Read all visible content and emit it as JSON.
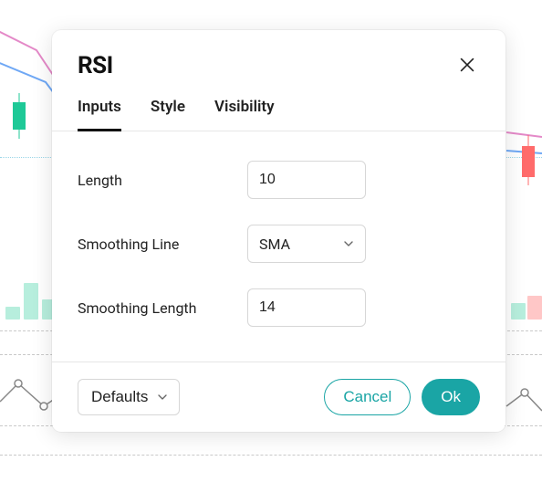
{
  "background": {
    "note": "faint trading chart behind modal",
    "visible_candle_colors": [
      "#1ec997",
      "#ff6b6b"
    ]
  },
  "modal": {
    "title": "RSI",
    "close_icon": "close-icon",
    "tabs": [
      {
        "label": "Inputs",
        "active": true
      },
      {
        "label": "Style",
        "active": false
      },
      {
        "label": "Visibility",
        "active": false
      }
    ],
    "inputs": {
      "length": {
        "label": "Length",
        "value": "10"
      },
      "smoothing_line": {
        "label": "Smoothing Line",
        "value": "SMA"
      },
      "smoothing_length": {
        "label": "Smoothing Length",
        "value": "14"
      }
    },
    "footer": {
      "defaults_label": "Defaults",
      "cancel_label": "Cancel",
      "ok_label": "Ok"
    },
    "colors": {
      "accent": "#1aa5a5"
    }
  }
}
